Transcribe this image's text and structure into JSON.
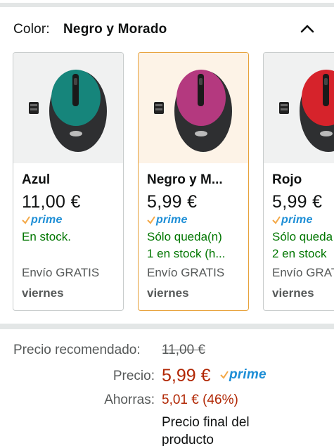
{
  "color_selector": {
    "label": "Color:",
    "selected": "Negro y Morado"
  },
  "variants": [
    {
      "name": "Azul",
      "price": "11,00 €",
      "prime": "prime",
      "stock_line1": "En stock.",
      "stock_line2": "",
      "shipping": "Envío GRATIS",
      "delivery_day": "viernes",
      "mouse_color": "#16857b",
      "selected": false
    },
    {
      "name": "Negro y M...",
      "price": "5,99 €",
      "prime": "prime",
      "stock_line1": "Sólo queda(n)",
      "stock_line2": "1 en stock (h...",
      "shipping": "Envío GRATIS",
      "delivery_day": "viernes",
      "mouse_color": "#b4397f",
      "selected": true
    },
    {
      "name": "Rojo",
      "price": "5,99 €",
      "prime": "prime",
      "stock_line1": "Sólo queda",
      "stock_line2": "2 en stock",
      "shipping": "Envío GRAT",
      "delivery_day": "viernes",
      "mouse_color": "#d6232b",
      "selected": false
    }
  ],
  "pricing": {
    "recommended_label": "Precio recomendado:",
    "recommended_value": "11,00 €",
    "price_label": "Precio:",
    "price_value": "5,99 €",
    "prime": "prime",
    "savings_label": "Ahorras:",
    "savings_value": "5,01 € (46%)",
    "final_price_line1": "Precio final del",
    "final_price_line2": "producto"
  },
  "colors": {
    "prime_blue": "#1d8ed6",
    "prime_check": "#f3a847",
    "in_stock_green": "#007600",
    "price_red": "#b12704",
    "selected_border": "#e7a13a"
  }
}
